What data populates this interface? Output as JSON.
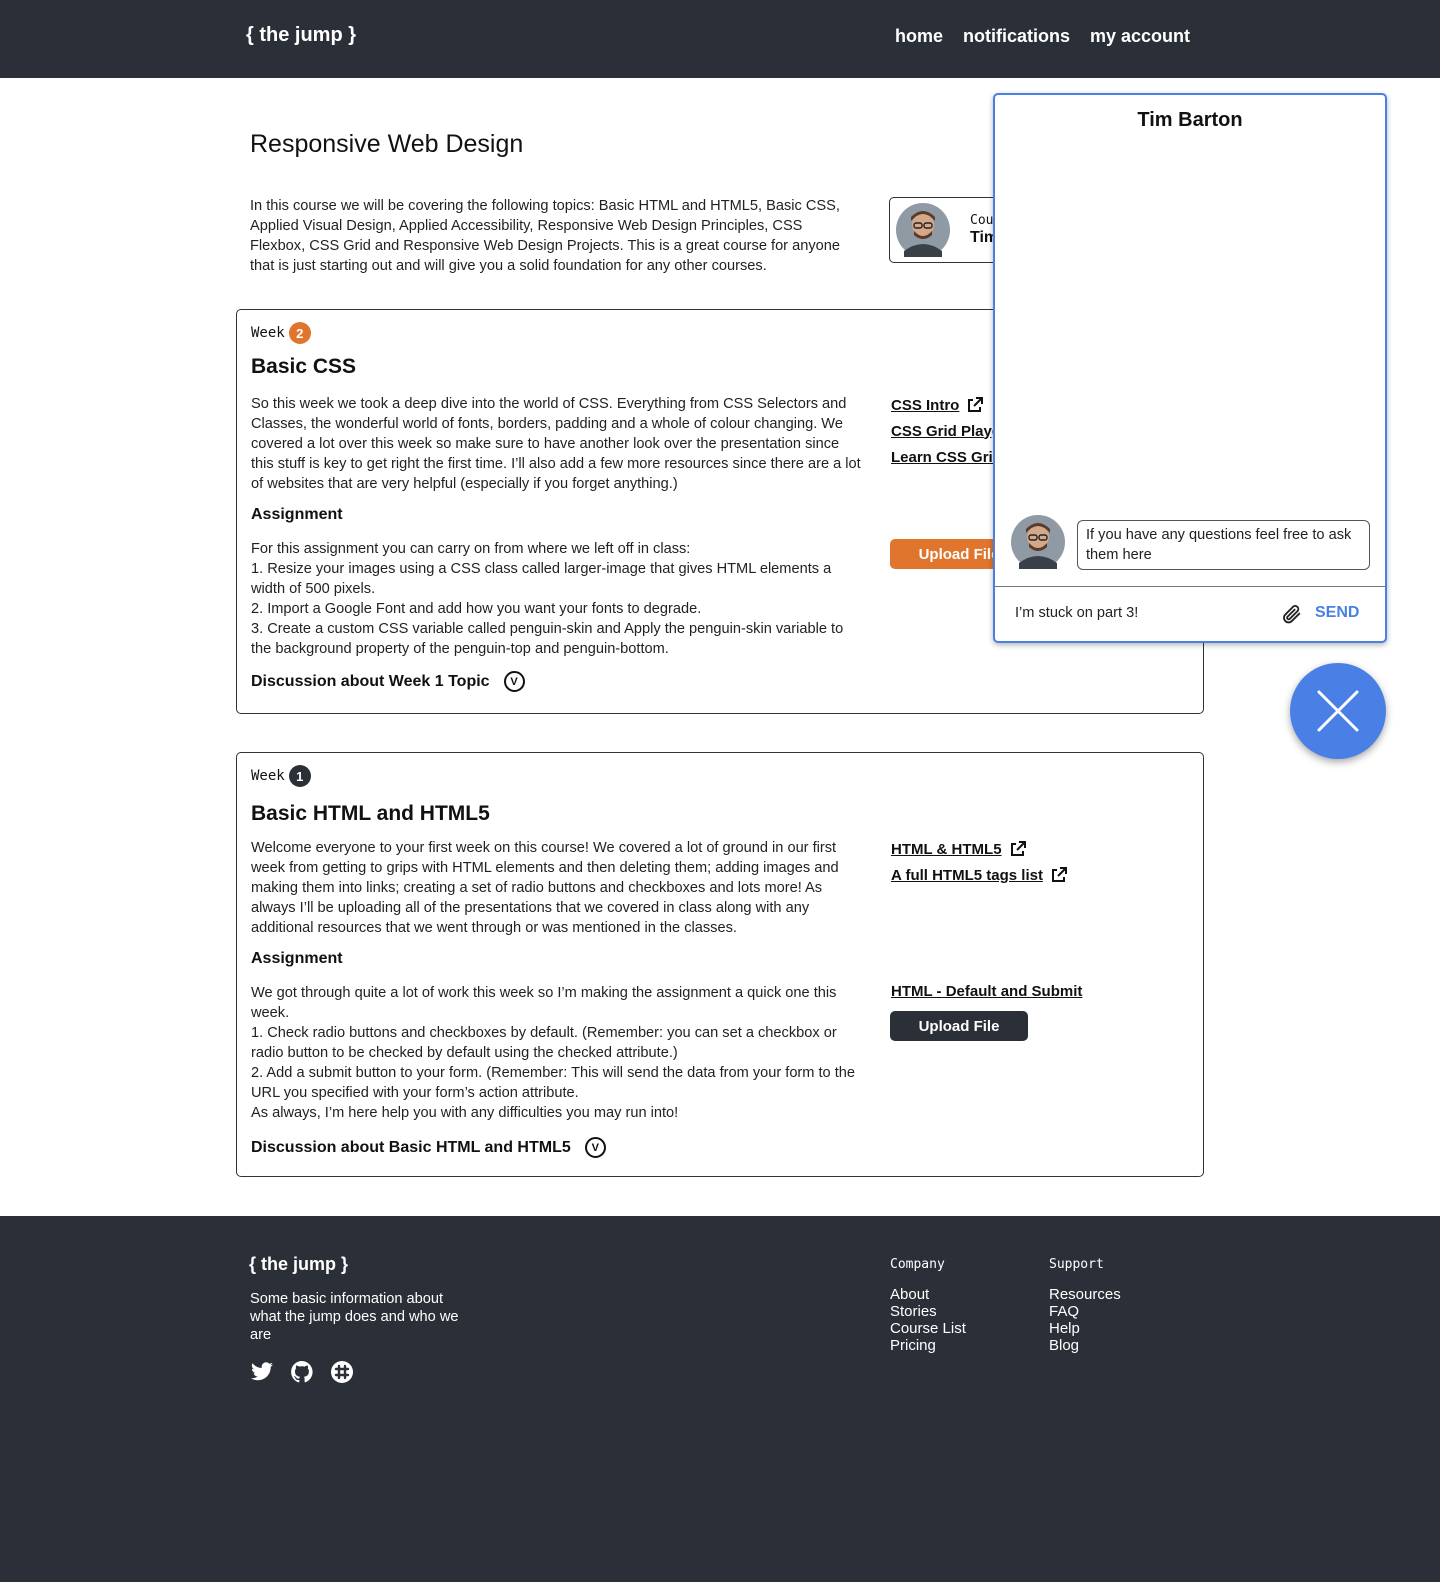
{
  "header": {
    "logo": "{ the jump }",
    "nav": [
      "home",
      "notifications",
      "my account"
    ]
  },
  "course": {
    "title": "Responsive Web Design",
    "description": "In this course we will be covering the following topics: Basic HTML and HTML5, Basic CSS, Applied Visual Design, Applied Accessibility, Responsive Web Design Principles, CSS Flexbox, CSS Grid and Responsive Web Design Projects. This is a great course for anyone that is just starting out and will give you a solid foundation for any other courses.",
    "instructor_label": "Cou",
    "instructor_name": "Tim"
  },
  "weeks": [
    {
      "label": "Week",
      "number": "2",
      "badge_color": "#e0752d",
      "title": "Basic CSS",
      "body": "So this week we took a deep dive into the world of CSS. Everything from CSS Selectors and Classes, the wonderful world of fonts, borders, padding and a whole of colour changing. We covered a lot over this week so make sure to have another look over the presentation since this stuff is key to get right the first time. I’ll also add a few more resources since there are a lot of websites that are very helpful (especially if you forget anything.)",
      "links": [
        "CSS Intro",
        "CSS Grid Playg",
        "Learn CSS Grid"
      ],
      "assignment_heading": "Assignment",
      "assignment": "For this assignment you can carry on from where we left off in class:\n1. Resize your images using a CSS class called larger-image that gives HTML elements a width of 500 pixels.\n2. Import a Google Font and add how you want your fonts to degrade.\n3. Create a custom CSS variable called penguin-skin and Apply the penguin-skin variable to the background property of the penguin-top and penguin-bottom.",
      "upload_label": "Upload File",
      "upload_color": "#e0752d",
      "discussion": "Discussion about Week 1 Topic"
    },
    {
      "label": "Week",
      "number": "1",
      "badge_color": "#2b2f37",
      "title": "Basic HTML and HTML5",
      "body": "Welcome everyone to your first week on this course! We covered a lot of ground in our first week from getting to grips with HTML elements and then deleting them; adding images and making them into links; creating a set of radio buttons and checkboxes and lots more! As always I’ll be uploading all of the presentations that we covered in class along with any additional resources that we went through or was mentioned in the classes.",
      "links": [
        "HTML & HTML5",
        "A full HTML5 tags list"
      ],
      "assignment_heading": "Assignment",
      "assignment": "We got through quite a lot of work this week so I’m making the assignment a quick one this week.\n1. Check radio buttons and checkboxes by default. (Remember: you can set a checkbox or radio button to be checked by default using the checked attribute.)\n2. Add a submit button to your form. (Remember: This will send the data from your form to the URL you specified with your form’s action attribute.\nAs always, I’m here help you with any difficulties you may run into!",
      "file_link": "HTML - Default and Submit",
      "upload_label": "Upload File",
      "upload_color": "#2b2f37",
      "discussion": "Discussion about Basic HTML and HTML5"
    }
  ],
  "chat": {
    "title": "Tim Barton",
    "message": "If you have any questions feel free to ask them here",
    "input_value": "I’m stuck on part 3!",
    "send_label": "SEND",
    "accent": "#4a7fe6"
  },
  "footer": {
    "logo": "{ the jump }",
    "description": "Some basic information about what the jump does and who we are",
    "socials": [
      "twitter-icon",
      "github-icon",
      "slack-icon"
    ],
    "company_heading": "Company",
    "company_links": [
      "About",
      "Stories",
      "Course List",
      "Pricing"
    ],
    "support_heading": "Support",
    "support_links": [
      "Resources",
      "FAQ",
      "Help",
      "Blog"
    ]
  }
}
